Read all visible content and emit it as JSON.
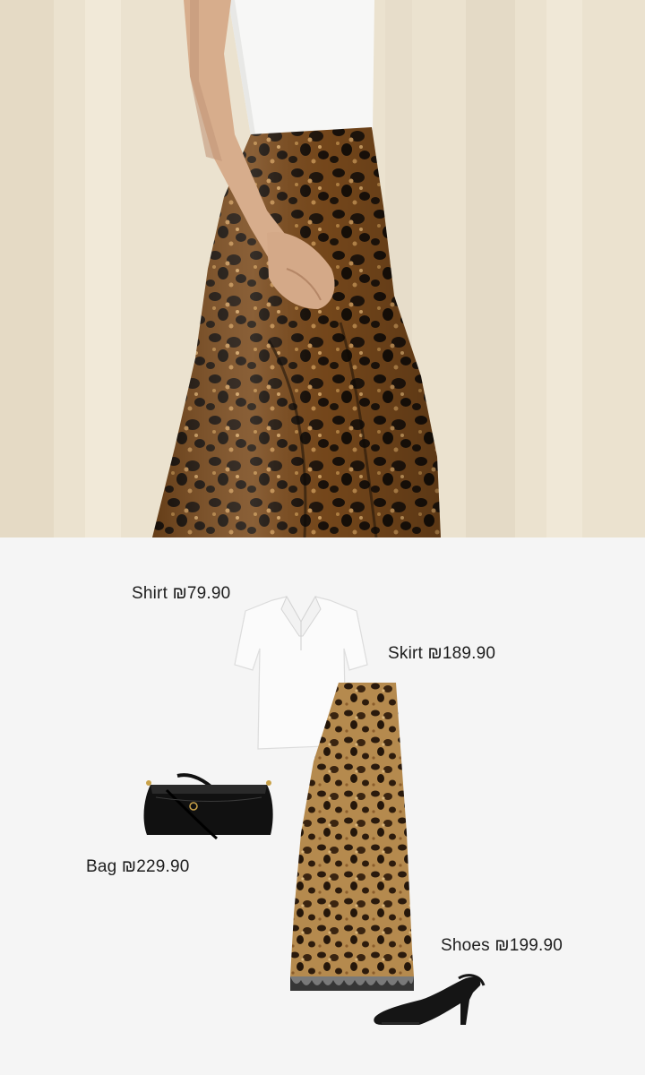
{
  "hero_image": {
    "subject": "model-in-leopard-skirt"
  },
  "outfit": {
    "shirt": {
      "name": "Shirt",
      "price": "₪79.90"
    },
    "skirt": {
      "name": "Skirt",
      "price": "₪189.90"
    },
    "bag": {
      "name": "Bag",
      "price": "₪229.90"
    },
    "shoes": {
      "name": "Shoes",
      "price": "₪199.90"
    }
  },
  "colors": {
    "background": "#f5f5f5",
    "backdrop": "#ece3d0",
    "leopard_base": "#8a5a26",
    "leopard_spot": "#1c130b",
    "shirt": "#fbfbfb",
    "bag": "#111111",
    "shoe": "#151515",
    "text": "#1d1d1d"
  }
}
